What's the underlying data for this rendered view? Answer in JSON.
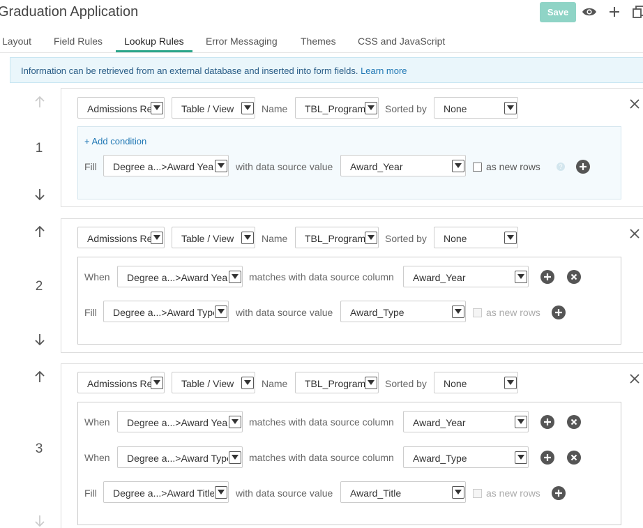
{
  "app": {
    "title": "Graduation Application",
    "save_label": "Save"
  },
  "icons": [
    "eye-icon",
    "plus-icon",
    "copy-icon",
    "arrow-up-icon",
    "arrow-down-icon",
    "close-icon",
    "add-circle-icon",
    "remove-circle-icon",
    "help-icon",
    "chevron-down-icon"
  ],
  "colors": {
    "accent": "#2ba58a",
    "save_bg": "#8fd4c6",
    "info_bg": "#eaf6fb",
    "link": "#1f77b4"
  },
  "tabs": [
    {
      "label": "Layout",
      "active": false
    },
    {
      "label": "Field Rules",
      "active": false
    },
    {
      "label": "Lookup Rules",
      "active": true
    },
    {
      "label": "Error Messaging",
      "active": false
    },
    {
      "label": "Themes",
      "active": false
    },
    {
      "label": "CSS and JavaScript",
      "active": false
    }
  ],
  "info": {
    "text": "Information can be retrieved from an external database and inserted into form fields.",
    "link": "Learn more"
  },
  "labels": {
    "name": "Name",
    "sorted_by": "Sorted by",
    "fill": "Fill",
    "when": "When",
    "with_value": "with data source value",
    "matches": "matches with data source column",
    "as_new_rows": "as new rows",
    "add_condition": "+ Add condition",
    "help": "?"
  },
  "rules": [
    {
      "number": "1",
      "source": "Admissions Re",
      "type": "Table / View",
      "name": "TBL_Program",
      "sorted": "None",
      "fills": [
        {
          "field": "Degree a...>Award Year",
          "value": "Award_Year",
          "as_new_rows_enabled": true
        }
      ]
    },
    {
      "number": "2",
      "source": "Admissions Re",
      "type": "Table / View",
      "name": "TBL_Program",
      "sorted": "None",
      "conditions": [
        {
          "field": "Degree a...>Award Year",
          "column": "Award_Year"
        }
      ],
      "fills": [
        {
          "field": "Degree a...>Award Type",
          "value": "Award_Type",
          "as_new_rows_enabled": false
        }
      ]
    },
    {
      "number": "3",
      "source": "Admissions Re",
      "type": "Table / View",
      "name": "TBL_Program",
      "sorted": "None",
      "conditions": [
        {
          "field": "Degree a...>Award Year",
          "column": "Award_Year"
        },
        {
          "field": "Degree a...>Award Type",
          "column": "Award_Type"
        }
      ],
      "fills": [
        {
          "field": "Degree a...>Award Title",
          "value": "Award_Title",
          "as_new_rows_enabled": false
        }
      ]
    }
  ]
}
